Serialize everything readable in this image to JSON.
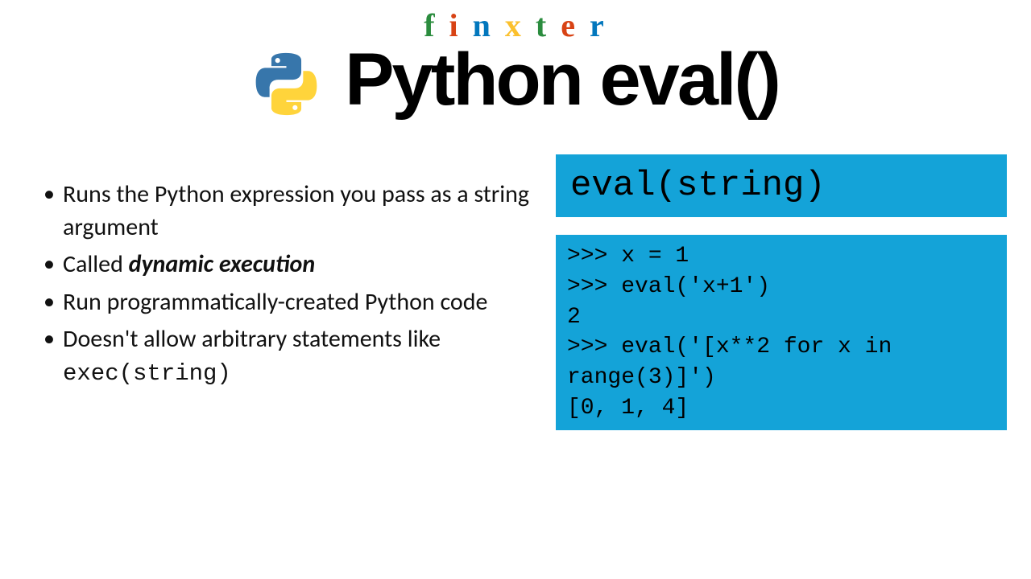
{
  "brand": {
    "letters": [
      "f",
      "i",
      "n",
      "x",
      "t",
      "e",
      "r"
    ],
    "colors": [
      "#2b8c3e",
      "#d84315",
      "#0277bd",
      "#fbc02d",
      "#2b8c3e",
      "#d84315",
      "#0277bd"
    ]
  },
  "title": "Python eval()",
  "bullets": [
    {
      "pre": "Runs the Python expression you pass as a string argument"
    },
    {
      "pre": "Called ",
      "bold": "dynamic execution"
    },
    {
      "pre": "Run programmatically-created Python code"
    },
    {
      "pre": "Doesn't allow arbitrary statements like ",
      "mono": "exec(string)"
    }
  ],
  "code_header": "eval(string)",
  "code_example": ">>> x = 1\n>>> eval('x+1')\n2\n>>> eval('[x**2 for x in range(3)]')\n[0, 1, 4]"
}
